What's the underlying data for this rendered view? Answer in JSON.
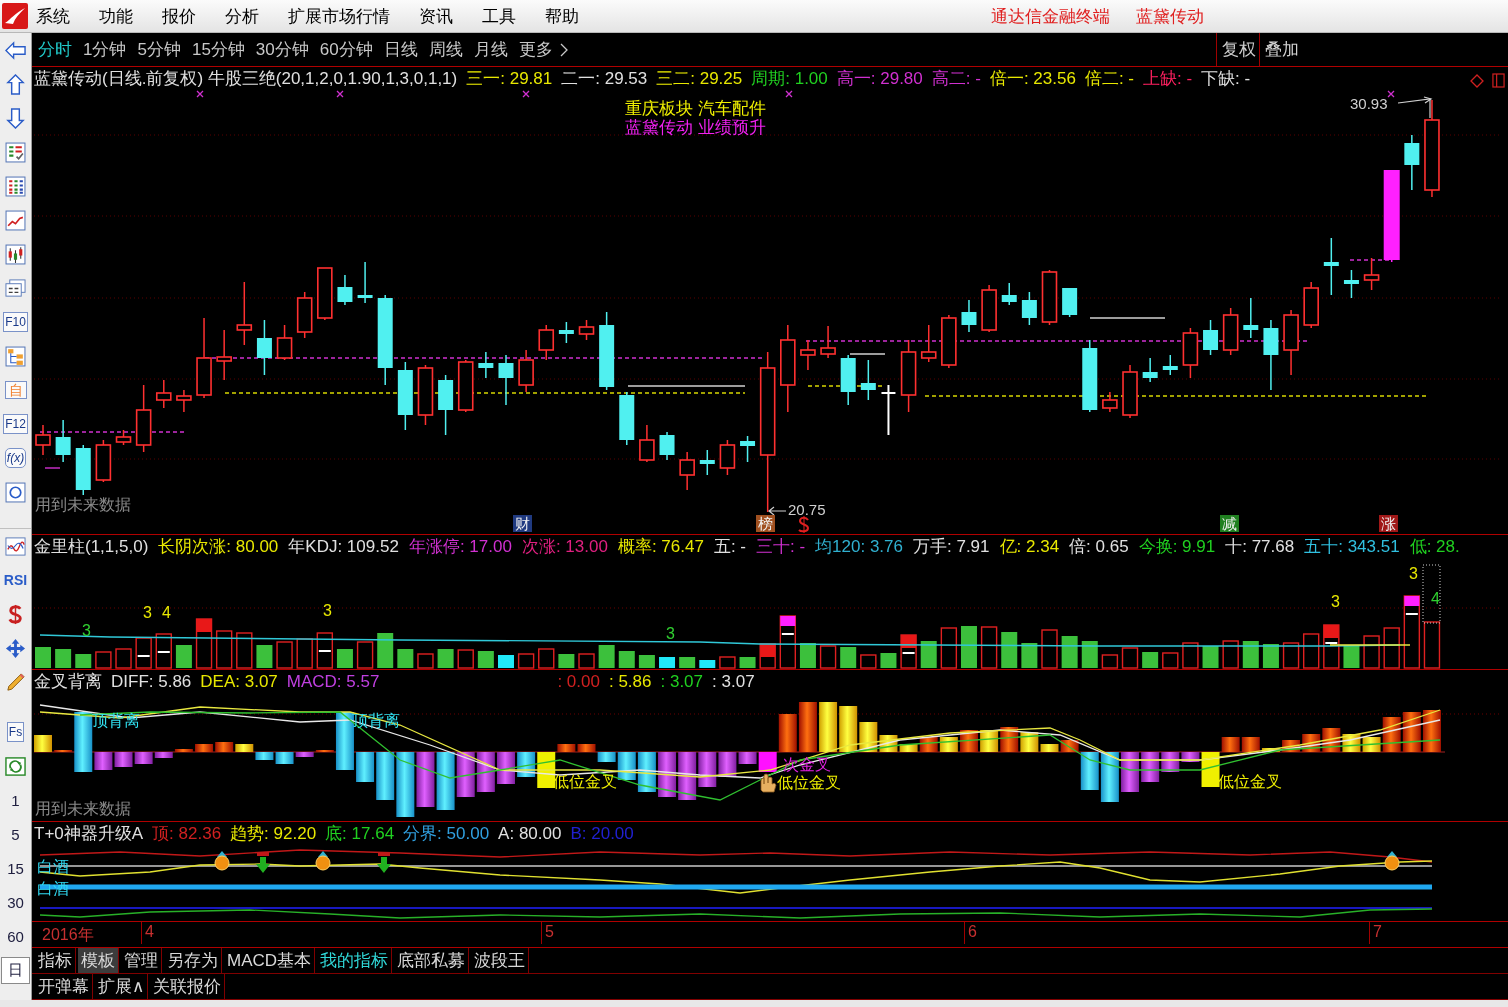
{
  "menu_bar": {
    "items": [
      "系统",
      "功能",
      "报价",
      "分析",
      "扩展市场行情",
      "资讯",
      "工具",
      "帮助"
    ],
    "app_name": "通达信金融终端",
    "stock_name": "蓝黛传动"
  },
  "side_toolbar": {
    "tool_labels": [
      "F10",
      "自",
      "F12",
      "f(x)",
      "RSI",
      "Fs"
    ],
    "periods": [
      {
        "label": "1",
        "selected": false
      },
      {
        "label": "5",
        "selected": false
      },
      {
        "label": "15",
        "selected": false
      },
      {
        "label": "30",
        "selected": false
      },
      {
        "label": "60",
        "selected": false
      },
      {
        "label": "日",
        "selected": true
      }
    ]
  },
  "period_tabs": [
    {
      "label": "分时",
      "selected": true
    },
    {
      "label": "1分钟",
      "selected": false
    },
    {
      "label": "5分钟",
      "selected": false
    },
    {
      "label": "15分钟",
      "selected": false
    },
    {
      "label": "30分钟",
      "selected": false
    },
    {
      "label": "60分钟",
      "selected": false
    },
    {
      "label": "日线",
      "selected": false
    },
    {
      "label": "周线",
      "selected": false
    },
    {
      "label": "月线",
      "selected": false
    },
    {
      "label": "更多",
      "selected": false
    }
  ],
  "chart_buttons": [
    "复权",
    "叠加"
  ],
  "price_chart": {
    "title": "蓝黛传动(日线.前复权) 牛股三绝(20,1,2,0,1.90,1,3,0,1,1)",
    "readings": [
      {
        "text": "三一: 29.81",
        "color": "#e8e800"
      },
      {
        "text": "二一: 29.53",
        "color": "#e0e0e0"
      },
      {
        "text": "三二: 29.25",
        "color": "#e8e800"
      },
      {
        "text": "周期: 1.00",
        "color": "#20d020"
      },
      {
        "text": "高一: 29.80",
        "color": "#d030d0"
      },
      {
        "text": "高二: -",
        "color": "#d030d0"
      },
      {
        "text": "倍一: 23.56",
        "color": "#e8e800"
      },
      {
        "text": "倍二: -",
        "color": "#e8e800"
      },
      {
        "text": "上缺: -",
        "color": "#ff2060"
      },
      {
        "text": "下缺: -",
        "color": "#e0e0e0"
      }
    ],
    "notes": [
      {
        "text": "重庆板块 汽车配件",
        "color": "#f0f000"
      },
      {
        "text": "蓝黛传动 业绩预升",
        "color": "#f020f0"
      }
    ],
    "high_label": "30.93",
    "low_label": "20.75",
    "warning": "用到未来数据",
    "event_tags": [
      {
        "text": "财",
        "color": "#203a80"
      },
      {
        "text": "榜",
        "color": "#a05020"
      },
      {
        "text": "减",
        "color": "#208020"
      },
      {
        "text": "涨",
        "color": "#a01818"
      }
    ]
  },
  "volume_panel": {
    "title": "金里柱(1,1,5,0)",
    "readings": [
      {
        "text": "长阴次涨: 80.00",
        "color": "#e8e800"
      },
      {
        "text": "年KDJ: 109.52",
        "color": "#e0e0e0"
      },
      {
        "text": "年涨停: 17.00",
        "color": "#d030d0"
      },
      {
        "text": "次涨: 13.00",
        "color": "#e02080"
      },
      {
        "text": "概率: 76.47",
        "color": "#e8e800"
      },
      {
        "text": "五: -",
        "color": "#e0e0e0"
      },
      {
        "text": "三十: -",
        "color": "#d030d0"
      },
      {
        "text": "均120: 3.76",
        "color": "#30b0d0"
      },
      {
        "text": "万手: 7.91",
        "color": "#e0e0e0"
      },
      {
        "text": "亿: 2.34",
        "color": "#e8e800"
      },
      {
        "text": "倍: 0.65",
        "color": "#e0e0e0"
      },
      {
        "text": "今换: 9.91",
        "color": "#20d020"
      },
      {
        "text": "十: 77.68",
        "color": "#e0e0e0"
      },
      {
        "text": "五十: 343.51",
        "color": "#30c0e0"
      },
      {
        "text": "低: 28.",
        "color": "#20d020"
      }
    ],
    "counts": [
      {
        "text": "3",
        "color": "#30d030"
      },
      {
        "text": "3",
        "color": "#e8e800"
      },
      {
        "text": "4",
        "color": "#e8e800"
      },
      {
        "text": "3",
        "color": "#e8e800"
      },
      {
        "text": "3",
        "color": "#30d030"
      },
      {
        "text": "3",
        "color": "#e8e800"
      },
      {
        "text": "3",
        "color": "#e8e800"
      },
      {
        "text": "4",
        "color": "#30d030"
      }
    ]
  },
  "macd_panel": {
    "title": "金叉背离",
    "readings": [
      {
        "text": "DIFF: 5.86",
        "color": "#e0e0e0"
      },
      {
        "text": "DEA: 3.07",
        "color": "#e8e800"
      },
      {
        "text": "MACD: 5.57",
        "color": "#c040e0"
      }
    ],
    "extra_readings": [
      {
        "text": ": 0.00",
        "color": "#d02020"
      },
      {
        "text": ": 5.86",
        "color": "#e8e800"
      },
      {
        "text": ": 3.07",
        "color": "#20d020"
      },
      {
        "text": ": 3.07",
        "color": "#e0e0e0"
      }
    ],
    "signals": [
      {
        "text": "顶背离",
        "color": "#30e0f0"
      },
      {
        "text": "顶背离",
        "color": "#30e0f0"
      },
      {
        "text": "低位金叉",
        "color": "#f0f000"
      },
      {
        "text": "次金叉",
        "color": "#e020e0"
      },
      {
        "text": "低位金叉",
        "color": "#f0f000"
      },
      {
        "text": "低位金叉",
        "color": "#f0f000"
      }
    ],
    "warning": "用到未来数据"
  },
  "t0_panel": {
    "title": "T+0神器升级A",
    "readings": [
      {
        "text": "顶: 82.36",
        "color": "#d02020"
      },
      {
        "text": "趋势: 92.20",
        "color": "#e8e800"
      },
      {
        "text": "底: 17.64",
        "color": "#20d020"
      },
      {
        "text": "分界: 50.00",
        "color": "#30a0e0"
      },
      {
        "text": "A: 80.00",
        "color": "#e0e0e0"
      },
      {
        "text": "B: 20.00",
        "color": "#2020d0"
      }
    ],
    "line_labels": [
      "白酒",
      "白酒"
    ]
  },
  "date_axis": {
    "year": "2016年",
    "months": [
      "4",
      "5",
      "6",
      "7"
    ]
  },
  "indicator_tabs": [
    {
      "label": "指标",
      "selected": false,
      "highlighted": false
    },
    {
      "label": "模板",
      "selected": true,
      "highlighted": false
    },
    {
      "label": "管理",
      "selected": false,
      "highlighted": false
    },
    {
      "label": "另存为",
      "selected": false,
      "highlighted": false
    },
    {
      "label": "MACD基本",
      "selected": false,
      "highlighted": false
    },
    {
      "label": "我的指标",
      "selected": false,
      "highlighted": true
    },
    {
      "label": "底部私募",
      "selected": false,
      "highlighted": false
    },
    {
      "label": "波段王",
      "selected": false,
      "highlighted": false
    }
  ],
  "bottom_tabs": [
    "开弹幕",
    "扩展∧",
    "关联报价"
  ]
}
